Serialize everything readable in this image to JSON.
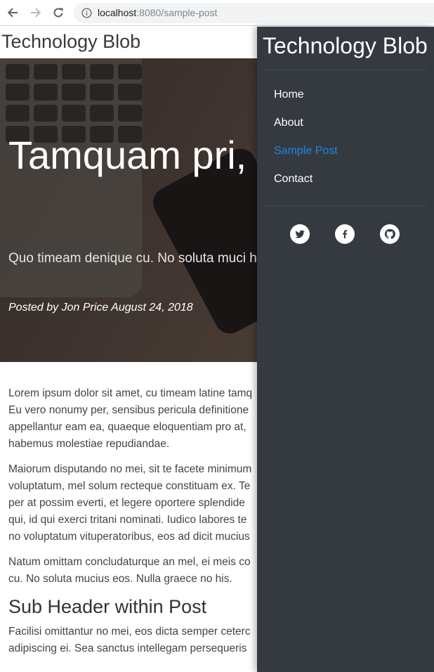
{
  "browser": {
    "url_host": "localhost",
    "url_rest": ":8080/sample-post"
  },
  "site": {
    "brand": "Technology Blob"
  },
  "post": {
    "title": "Tamquam pri, veniam his ea",
    "subtitle": "Quo timeam denique cu. No soluta muci his",
    "meta": "Posted by Jon Price August 24, 2018",
    "paragraphs": [
      "Lorem ipsum dolor sit amet, cu timeam latine tamq",
      "Eu vero nonumy per, sensibus pericula definitione",
      "appellantur eam ea, quaeque eloquentiam pro at,",
      "habemus molestiae repudiandae."
    ],
    "paragraph2": [
      "Maiorum disputando no mei, sit te facete minimum",
      "voluptatum, mel solum recteque constituam ex. Te",
      "per at possim everti, et legere oportere splendide",
      "qui, id qui exerci tritani nominati. Iudico labores te",
      "no voluptatum vituperatoribus, eos ad dicit mucius"
    ],
    "paragraph3": [
      "Natum omittam concludaturque an mel, ei meis co",
      "cu. No soluta mucius eos. Nulla graece no his."
    ],
    "subheader": "Sub Header within Post",
    "paragraph4": [
      "Facilisi omittantur no mei, eos dicta semper ceterc",
      "adipiscing ei. Sea sanctus intellegam persequeris"
    ]
  },
  "drawer": {
    "title": "Technology Blob",
    "nav": [
      {
        "label": "Home",
        "active": false
      },
      {
        "label": "About",
        "active": false
      },
      {
        "label": "Sample Post",
        "active": true
      },
      {
        "label": "Contact",
        "active": false
      }
    ],
    "social": [
      "twitter-icon",
      "facebook-icon",
      "github-icon"
    ],
    "colors": {
      "background": "#343a40",
      "active": "#1e88e5"
    }
  }
}
